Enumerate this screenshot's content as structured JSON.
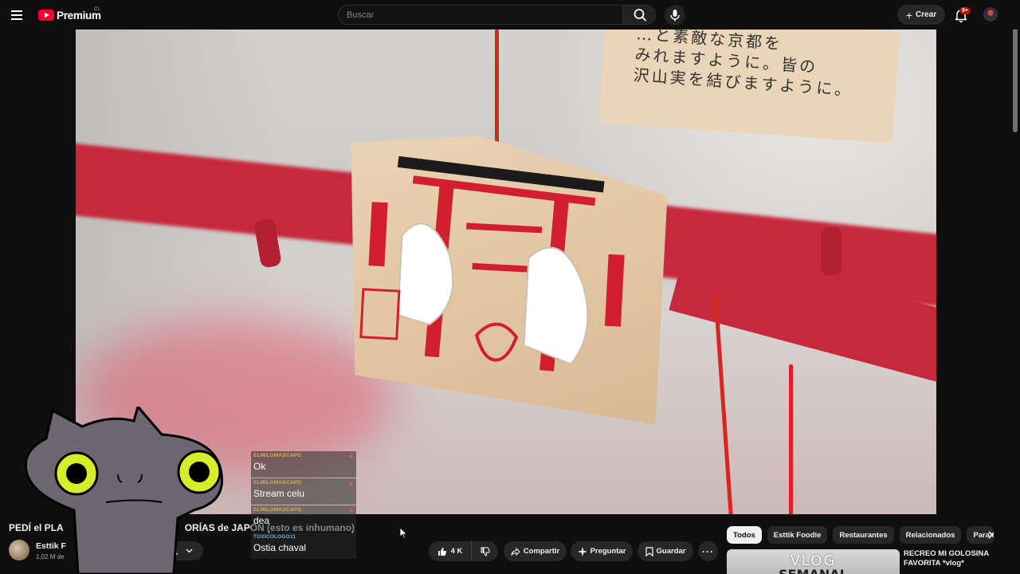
{
  "header": {
    "logo_text": "Premium",
    "country_code": "CL",
    "search_placeholder": "Buscar",
    "create_label": "Crear",
    "notifications_badge": "9+"
  },
  "video": {
    "title": "PEDÍ el PLATO MÁS CARO DE LAS CATEGORÍAS de JAPÓN (esto es inhumano)",
    "title_visible_start": "PEDÍ el PLA",
    "title_visible_end": "ORÍAS de JAPÓN (esto es inhumano)",
    "ema_text": "…と素敵な京都を\nみれますように。皆の\n沢山実を結びますように。"
  },
  "channel": {
    "name": "Esttik F",
    "subscribers": "1,02 M de"
  },
  "actions": {
    "likes": "4 K",
    "share": "Compartir",
    "ask": "Preguntar",
    "save": "Guardar"
  },
  "chips": [
    {
      "label": "Todos",
      "active": true
    },
    {
      "label": "Esttik Foodie",
      "active": false
    },
    {
      "label": "Restaurantes",
      "active": false
    },
    {
      "label": "Relacionados",
      "active": false
    },
    {
      "label": "Para t",
      "active": false
    }
  ],
  "recommendation": {
    "thumb_line1": "VLOG",
    "thumb_line2": "SEMANAL",
    "title": "RECREO MI GOLOSINA FAVORITA *vlog*"
  },
  "chat": [
    {
      "user": "ELMILOMASCAPO",
      "text": "Ok"
    },
    {
      "user": "ELMILOMASCAPO",
      "text": "Stream celu"
    },
    {
      "user": "ELMILOMASCAPO",
      "text": "dea"
    },
    {
      "user": "TOXICOLOGO11",
      "text": "Ostia chaval"
    }
  ],
  "colors": {
    "background": "#0f0f0f",
    "brand_red": "#ff0033",
    "pill_bg": "#272727",
    "chat_user_gold": "#d4b04a",
    "chat_user_blue": "#6ab2e8"
  }
}
